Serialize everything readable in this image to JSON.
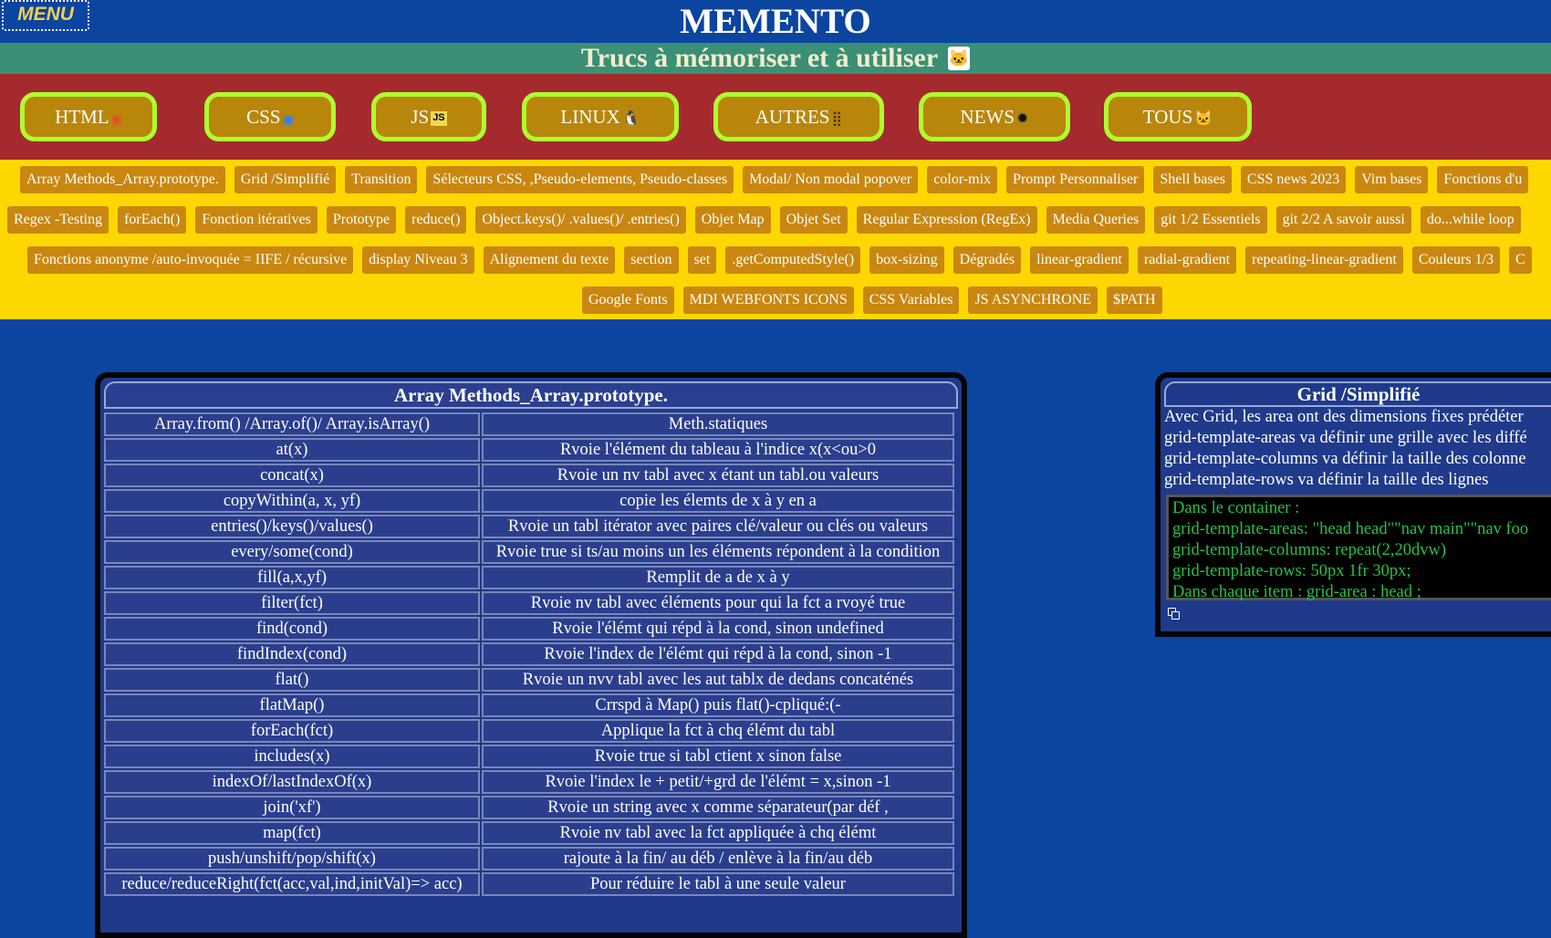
{
  "header": {
    "menu_label": "MENU",
    "title": "MEMENTO",
    "subtitle": "Trucs à mémoriser et à utiliser",
    "subtitle_icon": "🐱"
  },
  "categories": [
    {
      "label": "HTML",
      "icon": "html5-icon",
      "glyph": "🟧"
    },
    {
      "label": "CSS",
      "icon": "css3-icon",
      "glyph": "🟦"
    },
    {
      "label": "JS",
      "icon": "js-icon",
      "glyph": "JS"
    },
    {
      "label": "LINUX",
      "icon": "penguin-icon",
      "glyph": "🐧"
    },
    {
      "label": "AUTRES",
      "icon": "grid-dots-icon",
      "glyph": "⣿"
    },
    {
      "label": "NEWS",
      "icon": "news-burst-icon",
      "glyph": "✹"
    },
    {
      "label": "TOUS",
      "icon": "cat-icon",
      "glyph": "🐱"
    }
  ],
  "tags": {
    "row1": [
      "Array Methods_Array.prototype.",
      "Grid /Simplifié",
      "Transition",
      "Sélecteurs CSS, ,Pseudo-elements, Pseudo-classes",
      "Modal/ Non modal popover",
      "color-mix",
      "Prompt Personnaliser",
      "Shell bases",
      "CSS news 2023",
      "Vim bases",
      "Fonctions d'u"
    ],
    "row2": [
      "Regex -Testing",
      "forEach()",
      "Fonction itératives",
      "Prototype",
      "reduce()",
      "Object.keys()/ .values()/ .entries()",
      "Objet Map",
      "Objet Set",
      "Regular Expression (RegEx)",
      "Media Queries",
      "git 1/2 Essentiels",
      "git 2/2 A savoir aussi",
      "do...while loop"
    ],
    "row3": [
      "Fonctions anonyme /auto-invoquée = IIFE / récursive",
      "display Niveau 3",
      "Alignement du texte",
      "section",
      "set",
      ".getComputedStyle()",
      "box-sizing",
      "Dégradés",
      "linear-gradient",
      "radial-gradient",
      "repeating-linear-gradient",
      "Couleurs 1/3",
      "C"
    ],
    "row4": [
      "Google Fonts",
      "MDI WEBFONTS ICONS",
      "CSS Variables",
      "JS ASYNCHRONE",
      "$PATH"
    ]
  },
  "array_card": {
    "title": "Array Methods_Array.prototype.",
    "rows": [
      [
        "Array.from() /Array.of()/ Array.isArray()",
        "Meth.statiques"
      ],
      [
        "at(x)",
        "Rvoie l'élément du tableau à l'indice x(x<ou>0"
      ],
      [
        "concat(x)",
        "Rvoie un nv tabl avec x étant un tabl.ou valeurs"
      ],
      [
        "copyWithin(a, x, yf)",
        "copie les élemts de x à y en a"
      ],
      [
        "entries()/keys()/values()",
        "Rvoie un tabl itérator avec paires clé/valeur ou clés ou valeurs"
      ],
      [
        "every/some(cond)",
        "Rvoie true si ts/au moins un les éléments répondent à la condition"
      ],
      [
        "fill(a,x,yf)",
        "Remplit de a de x à y"
      ],
      [
        "filter(fct)",
        "Rvoie nv tabl avec éléments pour qui la fct a rvoyé true"
      ],
      [
        "find(cond)",
        "Rvoie l'élémt qui répd à la cond, sinon undefined"
      ],
      [
        "findIndex(cond)",
        "Rvoie l'index de l'élémt qui répd à la cond, sinon -1"
      ],
      [
        "flat()",
        "Rvoie un nvv tabl avec les aut tablx de dedans concaténés"
      ],
      [
        "flatMap()",
        "Crrspd à Map() puis flat()-cpliqué:(-"
      ],
      [
        "forEach(fct)",
        "Applique la fct à chq élémt du tabl"
      ],
      [
        "includes(x)",
        "Rvoie true si tabl ctient x sinon false"
      ],
      [
        "indexOf/lastIndexOf(x)",
        "Rvoie l'index le + petit/+grd de l'élémt = x,sinon -1"
      ],
      [
        "join('xf')",
        "Rvoie un string avec x comme séparateur(par déf ,"
      ],
      [
        "map(fct)",
        "Rvoie nv tabl avec la fct appliquée à chq élémt"
      ],
      [
        "push/unshift/pop/shift(x)",
        "rajoute à la fin/ au déb / enlève à la fin/au déb"
      ],
      [
        "reduce/reduceRight(fct(acc,val,ind,initVal)=> acc)",
        "Pour réduire le tabl à une seule valeur"
      ]
    ]
  },
  "grid_card": {
    "title": "Grid /Simplifié",
    "lines": [
      "Avec Grid, les area ont des dimensions fixes prédéter",
      "grid-template-areas va définir une grille avec les diffé",
      "grid-template-columns va définir la taille des colonne",
      "grid-template-rows va définir la taille des lignes"
    ],
    "code": [
      "Dans le container :",
      "grid-template-areas: \"head head\"\"nav main\"\"nav foo",
      "grid-template-columns: repeat(2,20dvw)",
      "grid-template-rows: 50px 1fr 30px;",
      "Dans chaque item : grid-area : head ;"
    ],
    "copy_icon": "copy-icon"
  },
  "colors": {
    "page_bg": "#0b45a0",
    "subtitle_band": "#3a8f76",
    "category_band": "#a52a2e",
    "category_border": "#adff2f",
    "category_fill": "#b8860b",
    "tags_band": "#ffd700",
    "tag_fill": "#c9870f",
    "code_text": "#22c244"
  }
}
